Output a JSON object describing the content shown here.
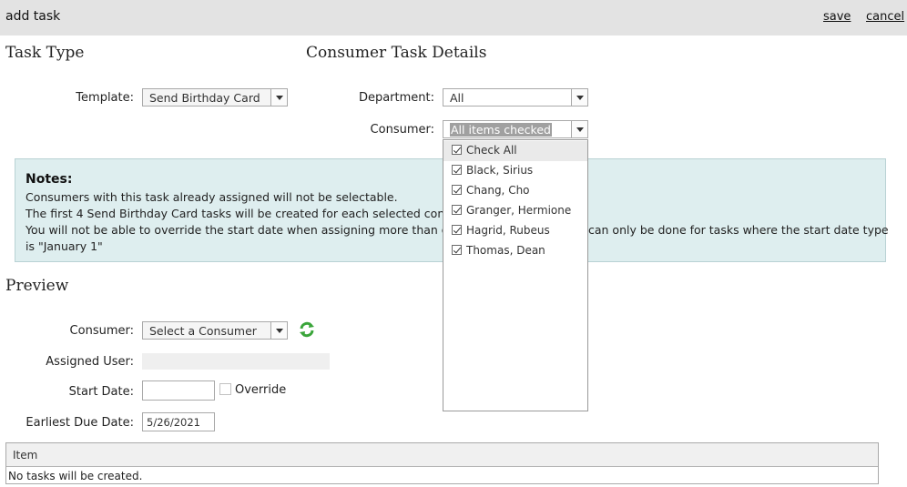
{
  "header": {
    "title": "add task",
    "save_label": "save",
    "cancel_label": "cancel"
  },
  "task_type": {
    "title": "Task Type",
    "template_label": "Template:",
    "template_value": "Send Birthday Card"
  },
  "details": {
    "title": "Consumer Task Details",
    "department_label": "Department:",
    "department_value": "All",
    "consumer_label": "Consumer:",
    "consumer_value": "All items checked",
    "consumer_options": [
      {
        "label": "Check All",
        "checked": true
      },
      {
        "label": "Black, Sirius",
        "checked": true
      },
      {
        "label": "Chang, Cho",
        "checked": true
      },
      {
        "label": "Granger, Hermione",
        "checked": true
      },
      {
        "label": "Hagrid, Rubeus",
        "checked": true
      },
      {
        "label": "Thomas, Dean",
        "checked": true
      }
    ]
  },
  "notes": {
    "title": "Notes:",
    "lines": [
      "Consumers with this task already assigned will not be selectable.",
      "The first 4 Send Birthday Card tasks will be created for each selected consum",
      "You will not be able to override the start date when assigning more than on",
      "is \"January 1\""
    ],
    "line3_tail": "can only be done for tasks where the start date type"
  },
  "preview": {
    "title": "Preview",
    "consumer_label": "Consumer:",
    "consumer_placeholder": "Select a Consumer",
    "assigned_user_label": "Assigned User:",
    "assigned_user_value": "",
    "start_date_label": "Start Date:",
    "start_date_value": "",
    "override_label": "Override",
    "override_checked": false,
    "earliest_due_label": "Earliest Due Date:",
    "earliest_due_value": "5/26/2021"
  },
  "grid": {
    "column_header": "Item",
    "empty_message": "No tasks will be created."
  },
  "colors": {
    "header_bg": "#e3e3e3",
    "notes_bg": "#deeeef",
    "refresh_green": "#3aa53a"
  }
}
